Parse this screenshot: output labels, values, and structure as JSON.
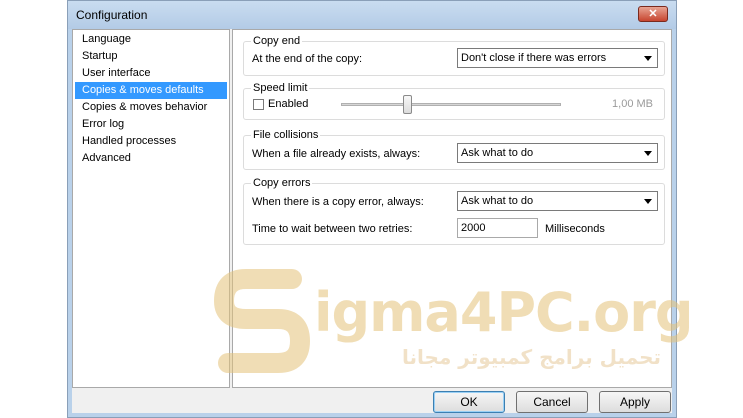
{
  "window": {
    "title": "Configuration",
    "close_label": "✕"
  },
  "nav": {
    "items": [
      {
        "label": "Language"
      },
      {
        "label": "Startup"
      },
      {
        "label": "User interface"
      },
      {
        "label": "Copies & moves defaults",
        "selected": true
      },
      {
        "label": "Copies & moves behavior"
      },
      {
        "label": "Error log"
      },
      {
        "label": "Handled processes"
      },
      {
        "label": "Advanced"
      }
    ]
  },
  "copy_end": {
    "title": "Copy end",
    "label": "At the end of the copy:",
    "value": "Don't close if there was errors"
  },
  "speed_limit": {
    "title": "Speed limit",
    "enabled_label": "Enabled",
    "enabled": false,
    "value_text": "1,00 MB",
    "slider_fraction": 0.3
  },
  "file_collisions": {
    "title": "File collisions",
    "label": "When a file already exists, always:",
    "value": "Ask what to do"
  },
  "copy_errors": {
    "title": "Copy errors",
    "label": "When there is a copy error, always:",
    "value": "Ask what to do",
    "retry_label": "Time to wait between two retries:",
    "retry_value": "2000",
    "retry_unit": "Milliseconds"
  },
  "buttons": {
    "ok": "OK",
    "cancel": "Cancel",
    "apply": "Apply"
  },
  "watermark": {
    "main": "igma4PC.org",
    "sub": "تحميل برامج كمبيوتر مجانا"
  },
  "colors": {
    "selection": "#3399ff",
    "watermark": "#e4c37a"
  }
}
